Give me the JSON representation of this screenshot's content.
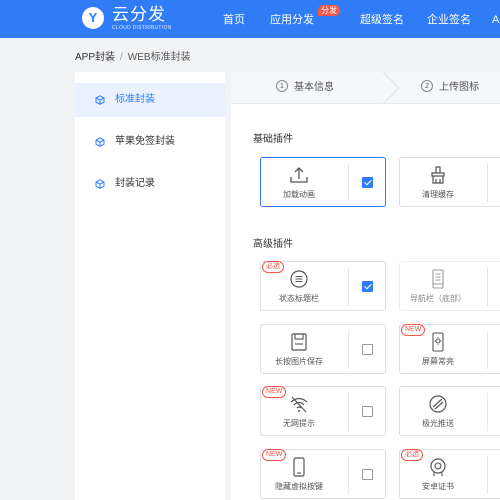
{
  "header": {
    "logo_letter": "Y",
    "logo_title": "云分发",
    "logo_subtitle": "CLOUD DISTRIBUTION",
    "nav": [
      {
        "label": "首页"
      },
      {
        "label": "应用分发",
        "badge": "分发"
      },
      {
        "label": "超级签名"
      },
      {
        "label": "企业签名"
      },
      {
        "label": "A"
      }
    ],
    "accent_color": "#2f7cf6"
  },
  "breadcrumb": {
    "root": "APP封装",
    "separator": "/",
    "current": "WEB标准封装"
  },
  "sidebar": {
    "items": [
      {
        "label": "标准封装",
        "icon": "cube-icon",
        "active": true
      },
      {
        "label": "苹果免签封装",
        "icon": "cube-icon",
        "active": false
      },
      {
        "label": "封装记录",
        "icon": "cube-icon",
        "active": false
      }
    ]
  },
  "steps": [
    {
      "num": "1",
      "label": "基本信息"
    },
    {
      "num": "2",
      "label": "上传图标"
    }
  ],
  "basic_plugins": {
    "title": "基础插件",
    "items": [
      {
        "label": "加载动画",
        "icon": "upload-icon",
        "checked": true,
        "selected": true
      },
      {
        "label": "清理缓存",
        "icon": "brush-icon",
        "checked": null,
        "selected": false
      }
    ]
  },
  "advanced_plugins": {
    "title": "高级插件",
    "items": [
      {
        "label": "状态标题栏",
        "icon": "list-circle-icon",
        "tag": "必选",
        "checked": true
      },
      {
        "label": "导航栏（底部）",
        "icon": "phone-nav-icon",
        "tag": "",
        "checked": null,
        "disabled": true
      },
      {
        "label": "长按图片保存",
        "icon": "save-icon",
        "tag": "",
        "checked": false
      },
      {
        "label": "屏幕常亮",
        "icon": "screen-light-icon",
        "tag": "NEW",
        "checked": null
      },
      {
        "label": "无网提示",
        "icon": "wifi-off-icon",
        "tag": "NEW",
        "checked": false
      },
      {
        "label": "极光推送",
        "icon": "push-icon",
        "tag": "",
        "checked": null
      },
      {
        "label": "隐藏虚拟按键",
        "icon": "phone-icon",
        "tag": "NEW",
        "checked": false
      },
      {
        "label": "安卓证书",
        "icon": "certificate-icon",
        "tag": "必选",
        "checked": null
      }
    ]
  }
}
